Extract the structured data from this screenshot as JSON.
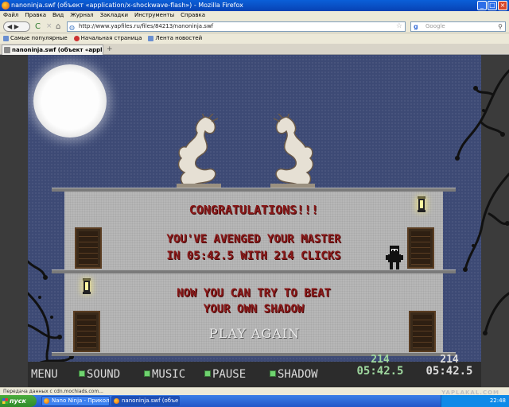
{
  "window": {
    "title": "nanoninja.swf (объект «application/x-shockwave-flash») - Mozilla Firefox",
    "minimize": "_",
    "maximize": "□",
    "close": "×"
  },
  "menubar": {
    "items": [
      "Файл",
      "Правка",
      "Вид",
      "Журнал",
      "Закладки",
      "Инструменты",
      "Справка"
    ]
  },
  "nav": {
    "back": "◀ ▶",
    "reload": "C",
    "stop": "×",
    "home": "⌂",
    "url": "http://www.yapfiles.ru/files/84213/nanoninja.swf",
    "search_engine": "g",
    "search_placeholder": "Google"
  },
  "bookmarks": {
    "items": [
      "Самые популярные",
      "Начальная страница",
      "Лента новостей"
    ]
  },
  "tabs": {
    "active": "nanoninja.swf (объект «application...",
    "new_tab": "+"
  },
  "game": {
    "title": "CONGRATULATIONS!!!",
    "line1": "YOU'VE AVENGED YOUR MASTER",
    "line2": "IN 05:42.5 WITH 214 CLICKS",
    "line3": "NOW YOU CAN TRY TO BEAT",
    "line4": "YOUR OWN SHADOW",
    "play_again": "PLAY AGAIN",
    "menu": {
      "menu": "MENU",
      "sound": "SOUND",
      "music": "MUSIC",
      "pause": "PAUSE",
      "shadow": "SHADOW"
    },
    "current": {
      "clicks": "214",
      "time": "05:42.5"
    },
    "best": {
      "clicks": "214",
      "time": "05:42.5"
    }
  },
  "statusbar": {
    "text": "Передача данных с cdn.mochiads.com..."
  },
  "taskbar": {
    "start": "пуск",
    "tasks": [
      "Nano Ninja - Прикол...",
      "nanoninja.swf (объе..."
    ],
    "clock": "22:48",
    "watermark": "YAPLAKAL.COM"
  }
}
